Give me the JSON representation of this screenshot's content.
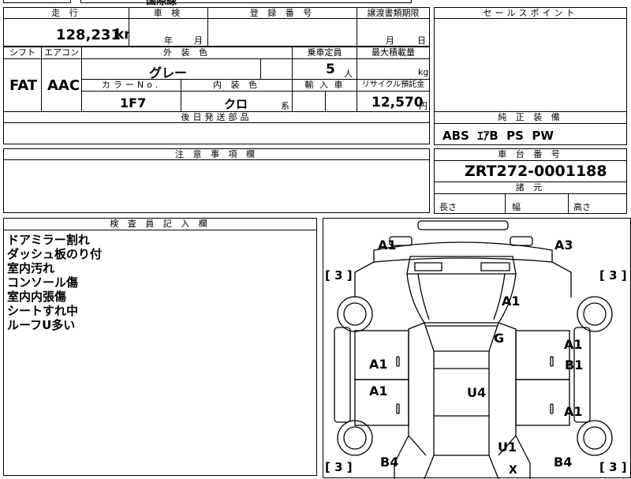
{
  "header": {
    "top_text": "国際線",
    "mileage_label": "走 行",
    "inspection_label": "車 検",
    "registration_label": "登 録 番 号",
    "transfer_label": "譲渡書類期限",
    "selling_points_label": "セールスポイント"
  },
  "mileage": {
    "value": "128,231",
    "unit": "km"
  },
  "inspection": {
    "year_unit": "年",
    "month_unit": "月"
  },
  "transfer": {
    "month_unit": "月",
    "day_unit": "日"
  },
  "specs": {
    "shift_label": "シフト",
    "aircon_label": "エアコン",
    "exterior_color_label": "外 装 色",
    "capacity_label": "乗車定員",
    "max_load_label": "最大積載量",
    "shift_value": "FAT",
    "aircon_value": "AAC",
    "exterior_color_value": "グレー",
    "capacity_value": "5",
    "capacity_unit": "人",
    "max_load_unit": "kg",
    "color_no_label": "カラーNo.",
    "interior_color_label": "内 装 色",
    "import_label": "輸 入 車",
    "recycle_label": "リサイクル預託金",
    "color_no_value": "1F7",
    "interior_color_value": "クロ",
    "interior_color_unit": "系",
    "recycle_value": "12,570",
    "recycle_unit": "円"
  },
  "later_parts_label": "後日発送部品",
  "notes_label": "注 意 事 項 欄",
  "standard_equipment": {
    "label": "純 正 装 備",
    "value": "ABS  ｴｱB  PS  PW"
  },
  "chassis": {
    "label": "車 台 番 号",
    "value": "ZRT272-0001188"
  },
  "dimensions": {
    "label": "諸 元",
    "length_label": "長さ",
    "width_label": "幅",
    "height_label": "高さ"
  },
  "inspector": {
    "label": "検 査 員 記 入 欄",
    "notes": [
      "ドアミラー割れ",
      "ダッシュ板のり付",
      "室内汚れ",
      "コンソール傷",
      "室内内張傷",
      "シートすれ中",
      "ルーフU多い"
    ]
  },
  "diagram": {
    "front_left": "A1",
    "front_right": "A3",
    "bracket_tl": "[ 3 ]",
    "bracket_tr": "[ 3 ]",
    "bracket_bl": "[ 3 ]",
    "bracket_br": "[ 3 ]",
    "hood": "A1",
    "windshield": "G",
    "left_front_door": "A1",
    "right_front_a": "A1",
    "right_front_b": "B1",
    "left_rear_door": "A1",
    "roof": "U4",
    "right_rear_door": "A1",
    "trunk": "U1",
    "rear_left": "B4",
    "rear_right": "B4",
    "rear_center": "X"
  }
}
